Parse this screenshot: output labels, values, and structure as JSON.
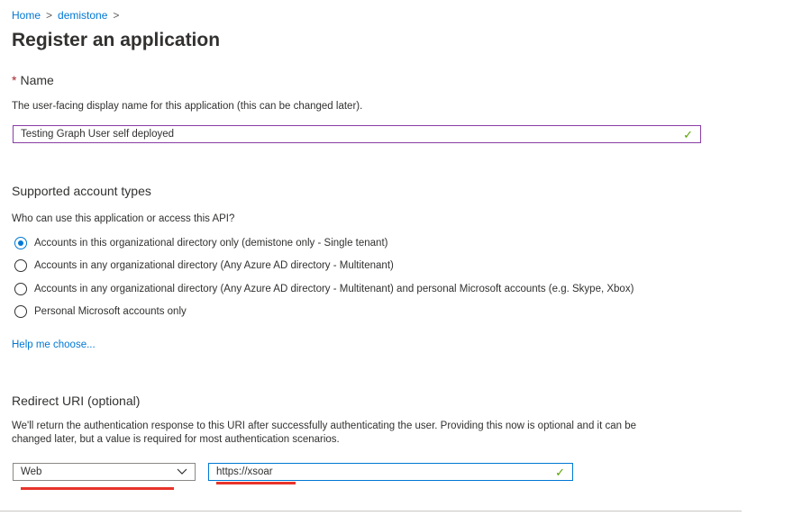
{
  "breadcrumb": {
    "items": [
      "Home",
      "demistone"
    ],
    "separator": ">"
  },
  "page_title": "Register an application",
  "name_section": {
    "required_marker": "*",
    "heading": "Name",
    "description": "The user-facing display name for this application (this can be changed later).",
    "input_value": "Testing Graph User self deployed",
    "valid_icon": "checkmark-icon"
  },
  "account_types": {
    "heading": "Supported account types",
    "question": "Who can use this application or access this API?",
    "options": [
      {
        "label": "Accounts in this organizational directory only (demistone only - Single tenant)",
        "selected": true
      },
      {
        "label": "Accounts in any organizational directory (Any Azure AD directory - Multitenant)",
        "selected": false
      },
      {
        "label": "Accounts in any organizational directory (Any Azure AD directory - Multitenant) and personal Microsoft accounts (e.g. Skype, Xbox)",
        "selected": false
      },
      {
        "label": "Personal Microsoft accounts only",
        "selected": false
      }
    ],
    "help_link": "Help me choose..."
  },
  "redirect_uri": {
    "heading": "Redirect URI (optional)",
    "description_line1": "We'll return the authentication response to this URI after successfully authenticating the user. Providing this now is optional and it can be",
    "description_line2": "changed later, but a value is required for most authentication scenarios.",
    "platform_value": "Web",
    "uri_value": "https://xsoar",
    "valid_icon": "checkmark-icon"
  },
  "colors": {
    "accent": "#0078d4",
    "valid": "#57a300",
    "annotation_underline": "#e8342a",
    "focused_border": "#8a3ea6"
  }
}
